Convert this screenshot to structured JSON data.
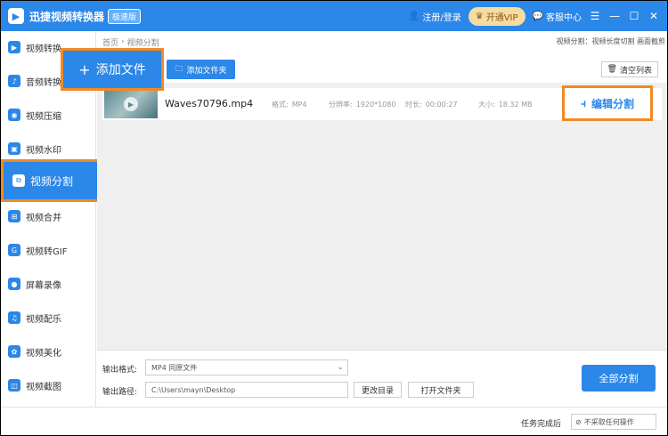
{
  "app": {
    "title": "迅捷视频转换器",
    "edition_badge": "极速版"
  },
  "titlebar": {
    "login_label": "注册/登录",
    "vip_label": "开通VIP",
    "support_label": "客服中心",
    "menu_glyph": "☰",
    "min_glyph": "—",
    "max_glyph": "☐",
    "close_glyph": "✕"
  },
  "sidebar": {
    "items": [
      {
        "label": "视频转换",
        "icon": "video-convert-icon"
      },
      {
        "label": "音频转换",
        "icon": "audio-convert-icon"
      },
      {
        "label": "视频压缩",
        "icon": "video-compress-icon"
      },
      {
        "label": "视频水印",
        "icon": "video-watermark-icon"
      },
      {
        "label": "视频分割",
        "icon": "video-split-icon"
      },
      {
        "label": "视频合并",
        "icon": "video-merge-icon"
      },
      {
        "label": "视频转GIF",
        "icon": "gif-icon"
      },
      {
        "label": "屏幕录像",
        "icon": "screen-record-icon"
      },
      {
        "label": "视频配乐",
        "icon": "music-icon"
      },
      {
        "label": "视频美化",
        "icon": "beautify-icon"
      },
      {
        "label": "视频截图",
        "icon": "screenshot-icon"
      }
    ]
  },
  "breadcrumb": {
    "home": "首页",
    "current": "视频分割"
  },
  "mode_label": "视频分割：视频长度切割 画面截剪",
  "toolbar": {
    "add_file": "添加文件",
    "add_folder": "添加文件夹",
    "clear_list": "清空列表"
  },
  "file": {
    "name": "Waves70796.mp4",
    "format_label": "格式:",
    "format": "MP4",
    "resolution_label": "分辨率:",
    "resolution": "1920*1080",
    "duration_label": "时长:",
    "duration": "00:00:27",
    "size_label": "大小:",
    "size": "18.32 MB",
    "action": "编辑分割"
  },
  "output": {
    "format_label": "输出格式:",
    "format_value": "MP4  同原文件",
    "path_label": "输出路径:",
    "path_value": "C:\\Users\\mayn\\Desktop",
    "change_dir": "更改目录",
    "open_folder": "打开文件夹",
    "split_all": "全部分割"
  },
  "footer": {
    "after_done_label": "任务完成后",
    "after_done_value": "不采取任何操作"
  },
  "colors": {
    "primary": "#2b87e8",
    "highlight_border": "#f08a24",
    "vip_bg": "#f6dca1"
  }
}
